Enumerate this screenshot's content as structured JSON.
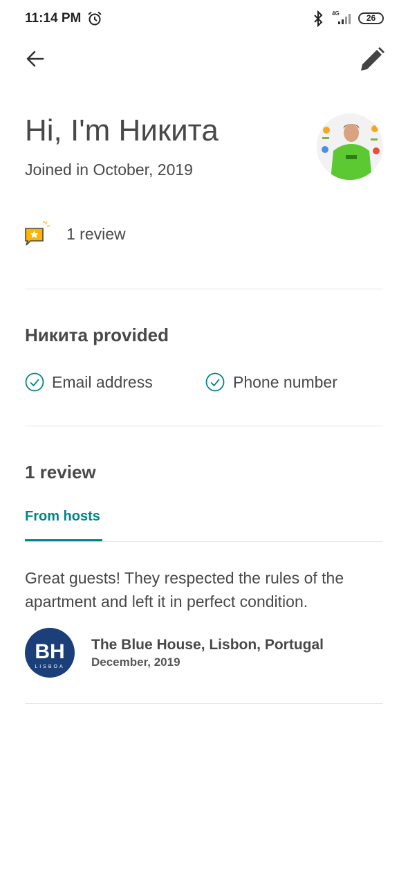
{
  "status_bar": {
    "time": "11:14 PM",
    "network": "4G",
    "battery": "26"
  },
  "profile": {
    "greeting": "Hi, I'm Никита",
    "joined": "Joined in October, 2019",
    "review_count": "1 review"
  },
  "provided": {
    "title": "Никита provided",
    "items": [
      {
        "label": "Email address",
        "icon": "check-circle-icon"
      },
      {
        "label": "Phone number",
        "icon": "check-circle-icon"
      }
    ]
  },
  "reviews": {
    "title": "1 review",
    "tab": "From hosts",
    "items": [
      {
        "text": "Great guests! They respected the rules of the apartment and left it in perfect condition.",
        "host_logo_text": "BH",
        "host_logo_subtext": "LISBOA",
        "host": "The Blue House, Lisbon, Portugal",
        "date": "December, 2019"
      }
    ]
  },
  "colors": {
    "accent": "#00848a",
    "text": "#484848",
    "logo_bg": "#1b3f78"
  }
}
